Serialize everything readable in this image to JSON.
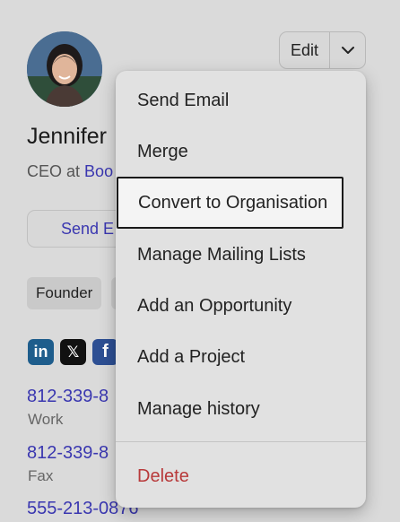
{
  "contact": {
    "name": "Jennifer",
    "title_prefix": "CEO at",
    "company": "Boo",
    "send_email_label": "Send E",
    "tags": [
      "Founder",
      ""
    ],
    "phones": [
      {
        "number": "812-339-8",
        "label": "Work"
      },
      {
        "number": "812-339-8",
        "label": "Fax"
      },
      {
        "number": "555-213-0876",
        "label": ""
      }
    ],
    "social_icons": [
      "linkedin-icon",
      "x-icon",
      "facebook-icon"
    ]
  },
  "toolbar": {
    "edit_label": "Edit",
    "dropdown_icon": "chevron-down-icon"
  },
  "menu": {
    "items": [
      {
        "label": "Send Email"
      },
      {
        "label": "Merge"
      },
      {
        "label": "Convert to Organisation"
      },
      {
        "label": "Manage Mailing Lists"
      },
      {
        "label": "Add an Opportunity"
      },
      {
        "label": "Add a Project"
      },
      {
        "label": "Manage history"
      }
    ],
    "delete_label": "Delete",
    "highlighted_index": 2
  },
  "colors": {
    "accent": "#3a37b0",
    "danger": "#b8393a",
    "linkedin": "#1e5d8c",
    "facebook": "#2d4f93"
  }
}
